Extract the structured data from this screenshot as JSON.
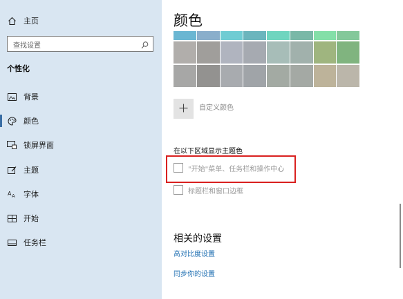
{
  "sidebar": {
    "home_label": "主页",
    "search_placeholder": "查找设置",
    "section_title": "个性化",
    "items": [
      {
        "label": "背景",
        "icon": "picture-icon"
      },
      {
        "label": "颜色",
        "icon": "palette-icon",
        "active": true
      },
      {
        "label": "锁屏界面",
        "icon": "lock-screen-icon"
      },
      {
        "label": "主题",
        "icon": "theme-brush-icon"
      },
      {
        "label": "字体",
        "icon": "font-icon"
      },
      {
        "label": "开始",
        "icon": "start-grid-icon"
      },
      {
        "label": "任务栏",
        "icon": "taskbar-icon"
      }
    ]
  },
  "main": {
    "title": "颜色",
    "swatch_top_row": [
      "#6ab6d2",
      "#8aaecb",
      "#6fccd3",
      "#6bb5bd",
      "#6fd5bf",
      "#7ab8a7",
      "#84dfa8",
      "#84c89a"
    ],
    "swatch_rows": [
      [
        "#b1aeab",
        "#a09e9b",
        "#b0b4bf",
        "#a6aab1",
        "#a7bdb8",
        "#a1b1ac",
        "#9fb57f",
        "#80b47f"
      ],
      [
        "#a7a7a6",
        "#939290",
        "#a8abaf",
        "#a0a4a8",
        "#a3aaa3",
        "#a4a9a4",
        "#bdb39a",
        "#bbb6aa"
      ]
    ],
    "custom_color_label": "自定义颜色",
    "accent_surfaces_heading": "在以下区域显示主题色",
    "checkbox_start": "\"开始\"菜单、任务栏和操作中心",
    "checkbox_titlebars": "标题栏和窗口边框",
    "related_heading": "相关的设置",
    "link_high_contrast": "高对比度设置",
    "link_sync": "同步你的设置"
  },
  "colors": {
    "sidebar_bg": "#d9e6f2",
    "link": "#1f6fb2",
    "highlight_box": "#d9201f"
  }
}
